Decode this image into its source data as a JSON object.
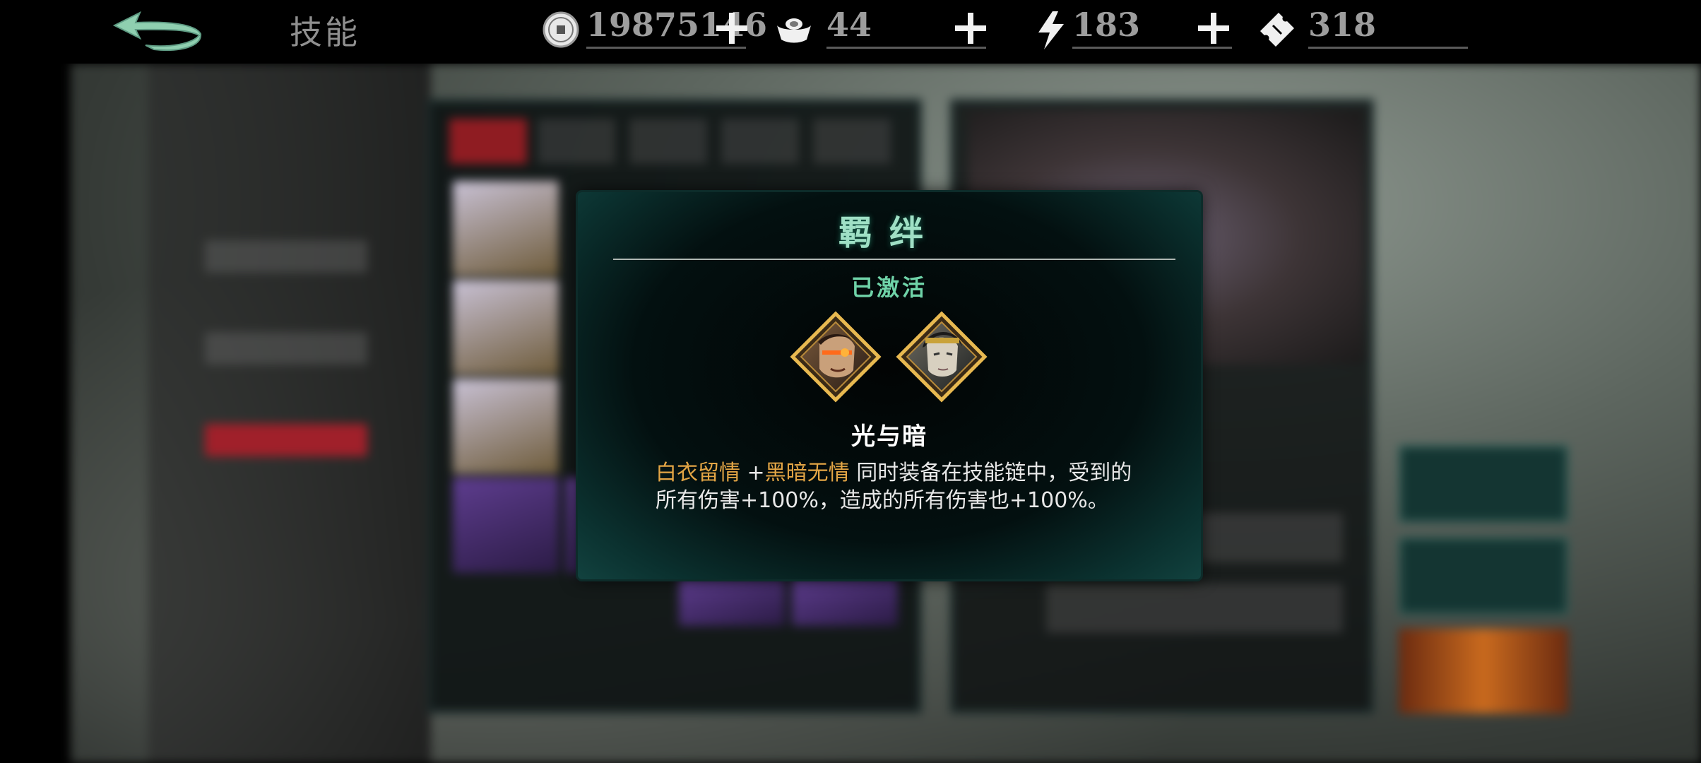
{
  "header": {
    "back_icon": "back-arrow-icon",
    "title": "技能",
    "resources": [
      {
        "icon": "copper-coin-icon",
        "value": "19875146"
      },
      {
        "icon": "silver-ingot-icon",
        "value": "44"
      },
      {
        "icon": "lightning-icon",
        "value": "183"
      },
      {
        "icon": "ticket-icon",
        "value": "318"
      }
    ]
  },
  "popup": {
    "title": "羁绊",
    "status": "已激活",
    "portraits": [
      "warrior-portrait-icon",
      "swordsman-portrait-icon"
    ],
    "bond_name": "光与暗",
    "description": {
      "skill_a": "白衣留情",
      "plus": " +",
      "skill_b": "黑暗无情",
      "text": " 同时装备在技能链中，受到的所有伤害+100%，造成的所有伤害也+100%。"
    }
  },
  "colors": {
    "title_green": "#9fe0c5",
    "status_green": "#6fd3a8",
    "skill_gold": "#e3a545",
    "resource_gray": "#9d9d9d"
  }
}
